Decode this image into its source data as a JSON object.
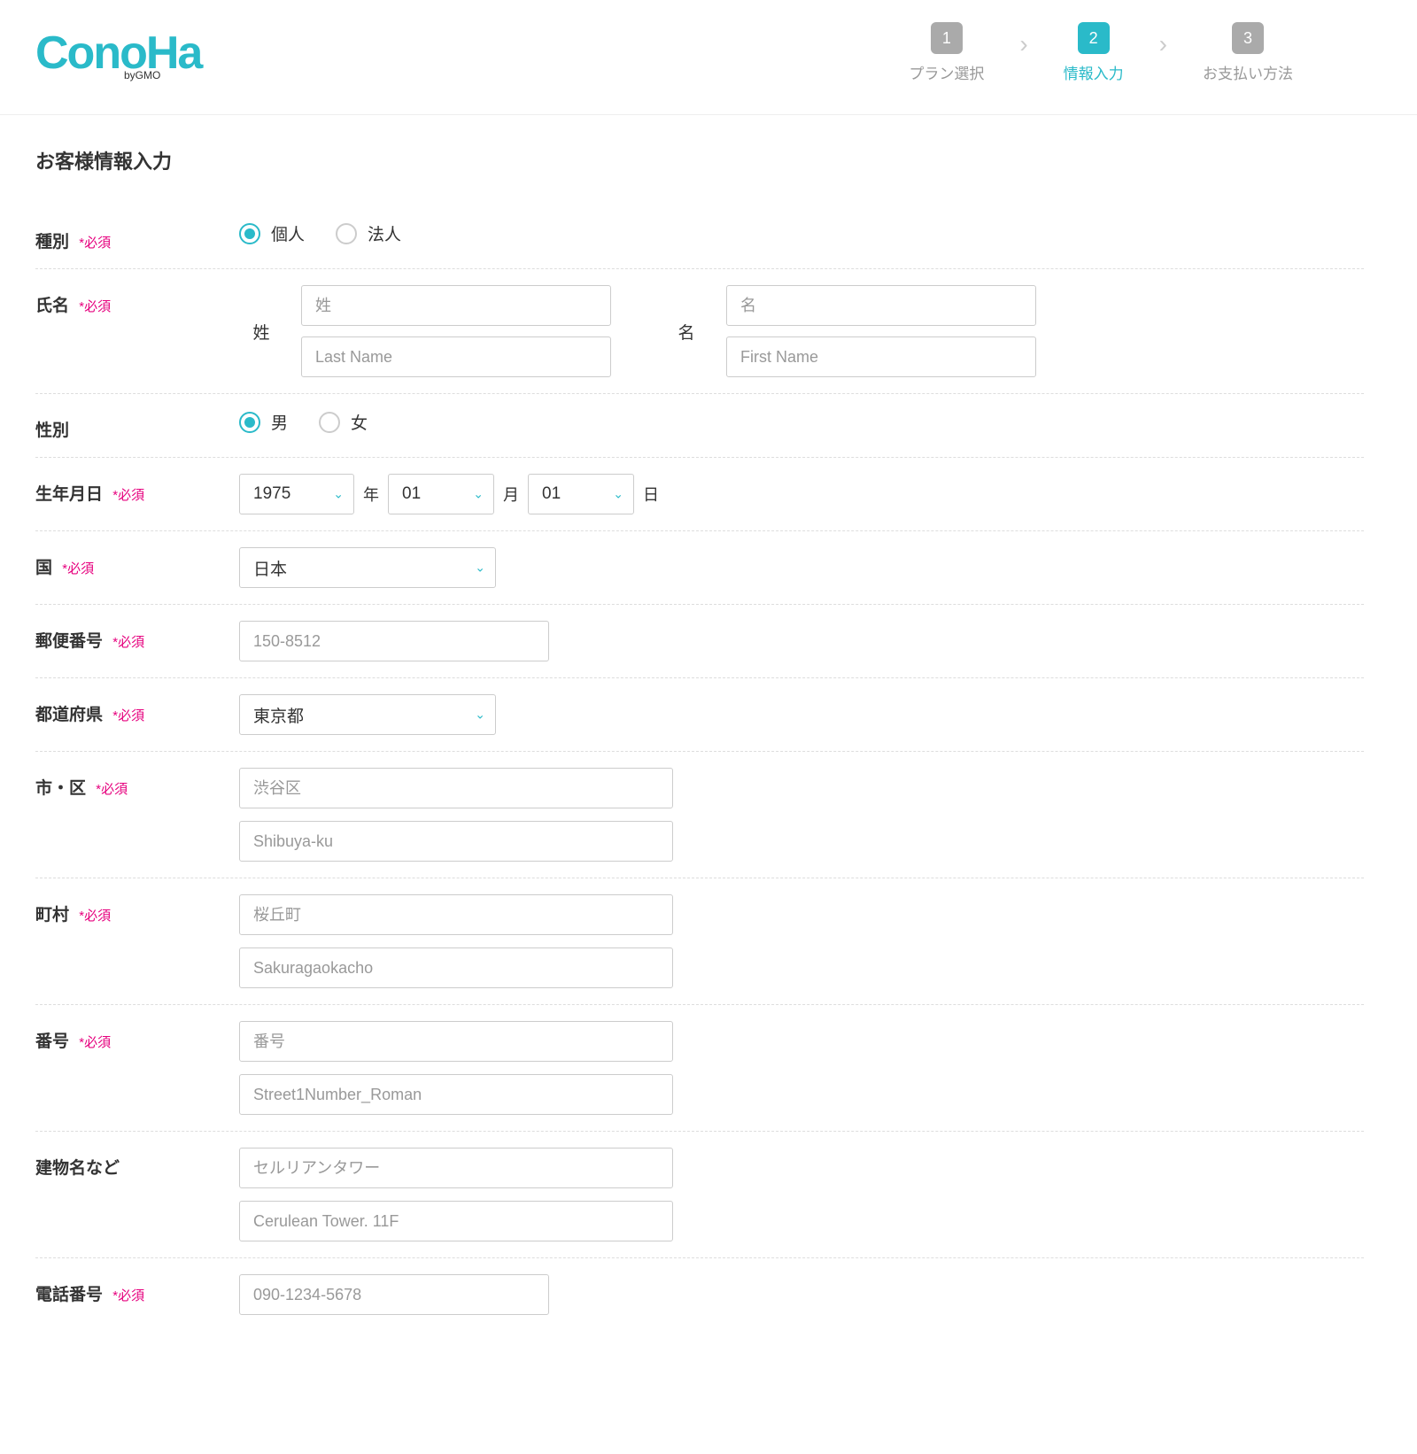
{
  "logo": {
    "text": "ConoHa",
    "subtext": "byGMO"
  },
  "steps": {
    "step1": {
      "num": "1",
      "label": "プラン選択"
    },
    "step2": {
      "num": "2",
      "label": "情報入力"
    },
    "step3": {
      "num": "3",
      "label": "お支払い方法"
    }
  },
  "page_title": "お客様情報入力",
  "required_text": "*必須",
  "labels": {
    "type": "種別",
    "name": "氏名",
    "gender": "性別",
    "birthdate": "生年月日",
    "country": "国",
    "postal": "郵便番号",
    "prefecture": "都道府県",
    "city": "市・区",
    "town": "町村",
    "street": "番号",
    "building": "建物名など",
    "phone": "電話番号"
  },
  "type_options": {
    "individual": "個人",
    "corporate": "法人"
  },
  "name_labels": {
    "sei": "姓",
    "mei": "名"
  },
  "name_placeholders": {
    "sei": "姓",
    "mei": "名",
    "lastname": "Last Name",
    "firstname": "First Name"
  },
  "gender_options": {
    "male": "男",
    "female": "女"
  },
  "birthdate": {
    "year": "1975",
    "month": "01",
    "day": "01",
    "year_unit": "年",
    "month_unit": "月",
    "day_unit": "日"
  },
  "country_value": "日本",
  "postal_placeholder": "150-8512",
  "prefecture_value": "東京都",
  "city_placeholders": {
    "jp": "渋谷区",
    "en": "Shibuya-ku"
  },
  "town_placeholders": {
    "jp": "桜丘町",
    "en": "Sakuragaokacho"
  },
  "street_placeholders": {
    "jp": "番号",
    "en": "Street1Number_Roman"
  },
  "building_placeholders": {
    "jp": "セルリアンタワー",
    "en": "Cerulean Tower. 11F"
  },
  "phone_placeholder": "090-1234-5678"
}
